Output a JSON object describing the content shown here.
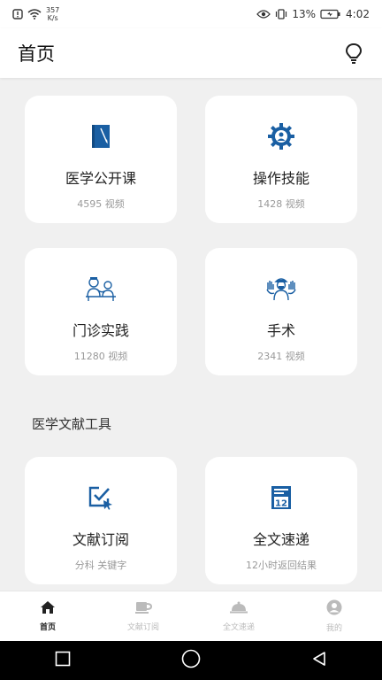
{
  "status": {
    "speed_value": "357",
    "speed_unit": "K/s",
    "battery_pct": "13%",
    "time": "4:02"
  },
  "header": {
    "title": "首页",
    "right_icon": "lightbulb-icon"
  },
  "cards": [
    {
      "title": "医学公开课",
      "subtitle": "4595 视频",
      "icon": "book-pen-icon"
    },
    {
      "title": "操作技能",
      "subtitle": "1428 视频",
      "icon": "gear-person-icon"
    },
    {
      "title": "门诊实践",
      "subtitle": "11280 视频",
      "icon": "doctor-patient-icon"
    },
    {
      "title": "手术",
      "subtitle": "2341 视频",
      "icon": "surgeon-icon"
    }
  ],
  "section": {
    "title": "医学文献工具"
  },
  "tools": [
    {
      "title": "文献订阅",
      "subtitle": "分科 关键字",
      "icon": "checkbox-cursor-icon"
    },
    {
      "title": "全文速递",
      "subtitle": "12小时返回结果",
      "icon": "calendar-12-icon"
    }
  ],
  "nav": [
    {
      "label": "首页",
      "icon": "home-icon",
      "active": true
    },
    {
      "label": "文献订阅",
      "icon": "cup-icon",
      "active": false
    },
    {
      "label": "全文速递",
      "icon": "cloche-icon",
      "active": false
    },
    {
      "label": "我的",
      "icon": "user-icon",
      "active": false
    }
  ],
  "colors": {
    "accent": "#1a5fa3",
    "background": "#f0f0f0",
    "card": "#ffffff"
  }
}
